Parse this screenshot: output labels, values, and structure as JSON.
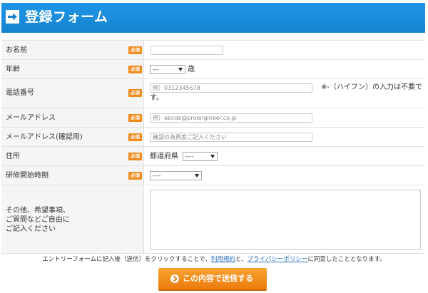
{
  "header": {
    "title": "登録フォーム",
    "icon": "arrow-right-icon"
  },
  "required_badge": "必須",
  "fields": {
    "name": {
      "label": "お名前",
      "value": "",
      "placeholder": ""
    },
    "age": {
      "label": "年齢",
      "selected": "---",
      "unit": "歳"
    },
    "phone": {
      "label": "電話番号",
      "placeholder": "例）0312345678",
      "note_line1": "※-（ハイフン）の入力は不要で",
      "note_line2": "す。"
    },
    "email": {
      "label": "メールアドレス",
      "placeholder": "例）abcde@proengineer.co.jp"
    },
    "email_confirm": {
      "label": "メールアドレス(確認用)",
      "placeholder": "確認の為再度ご記入ください"
    },
    "address": {
      "label": "住所",
      "prefix": "都道府県",
      "selected": "----"
    },
    "start": {
      "label": "研修開始時期",
      "selected": "----"
    },
    "other": {
      "label_line1": "その他、希望事項、",
      "label_line2": "ご質問などご自由に",
      "label_line3": "ご記入ください"
    }
  },
  "agreement": {
    "part1": "エントリーフォームに記入後（送信）をクリックすることで、",
    "link1": "利用規約",
    "part2": "と、",
    "link2": "プライバシーポリシー",
    "part3": "に同意したこととなります。"
  },
  "submit": {
    "label": "この内容で送信する"
  },
  "colors": {
    "header": "#1a8ddc",
    "badge": "#f08a1c",
    "submit": "#f39019",
    "link": "#2a6fbf"
  }
}
